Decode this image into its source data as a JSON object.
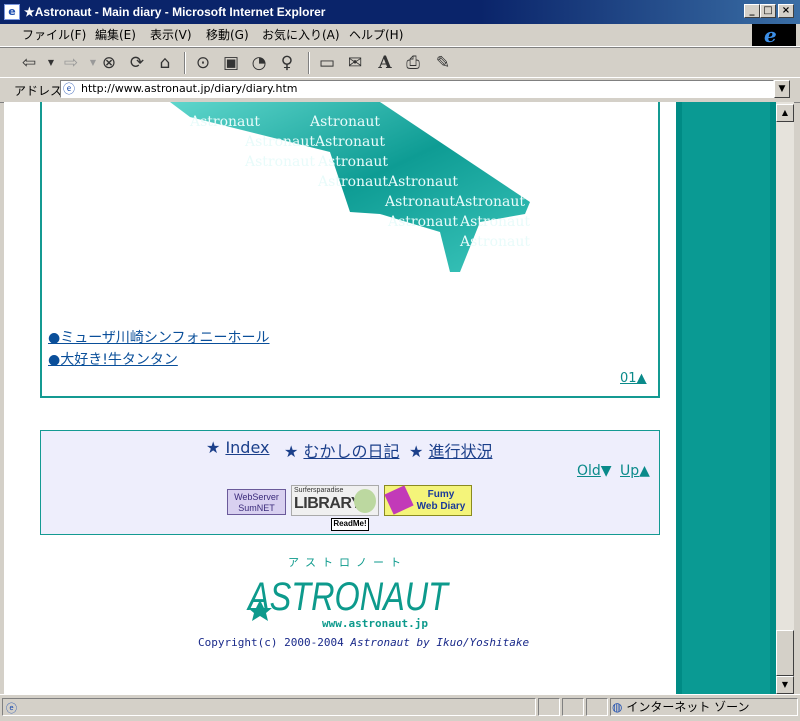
{
  "window": {
    "title": "★Astronaut - Main diary - Microsoft Internet Explorer"
  },
  "menu": [
    "ファイル(F)",
    "編集(E)",
    "表示(V)",
    "移動(G)",
    "お気に入り(A)",
    "ヘルプ(H)"
  ],
  "address": {
    "label": "アドレス",
    "url": "http://www.astronaut.jp/diary/diary.htm"
  },
  "toolbar_icons": [
    "back-icon",
    "forward-icon",
    "stop-icon",
    "refresh-icon",
    "home-icon",
    "search-icon",
    "favorites-icon",
    "history-icon",
    "channels-icon",
    "fullscreen-icon",
    "mail-icon",
    "font-icon",
    "print-icon",
    "edit-icon"
  ],
  "diary": {
    "logo_text": "Astronaut",
    "links": [
      "●ミューザ川崎シンフォニーホール",
      "●大好き!牛タンタン"
    ],
    "page_num": "01▲"
  },
  "nav": {
    "links": [
      {
        "star": "★",
        "label": "Index"
      },
      {
        "star": "★",
        "label": "むかしの日記"
      },
      {
        "star": "★",
        "label": "進行状況"
      }
    ],
    "old": {
      "label": "Old",
      "arrow": "▼"
    },
    "up": {
      "label": "Up",
      "arrow": "▲"
    },
    "banners": {
      "sumnet_line1": "WebServer",
      "sumnet_line2": "SumNET",
      "library_small": "Surfersparadise",
      "library_big": "LIBRARY",
      "fumy_line1": "Fumy",
      "fumy_line2": "Web Diary",
      "readme": "ReadMe!"
    }
  },
  "footer": {
    "logo_kana": "アストロノート",
    "logo_text": "ASTRONAUT",
    "url": "www.astronaut.jp",
    "copyright_prefix": "Copyright(c) 2000-2004 ",
    "copyright_italic": "Astronaut by Ikuo/Yoshitake"
  },
  "status": {
    "zone": "インターネット ゾーン"
  },
  "colors": {
    "teal": "#008b85",
    "link_blue": "#0a4f9a",
    "nav_bg": "#eeeefc",
    "title_bar": "#0a246a"
  }
}
